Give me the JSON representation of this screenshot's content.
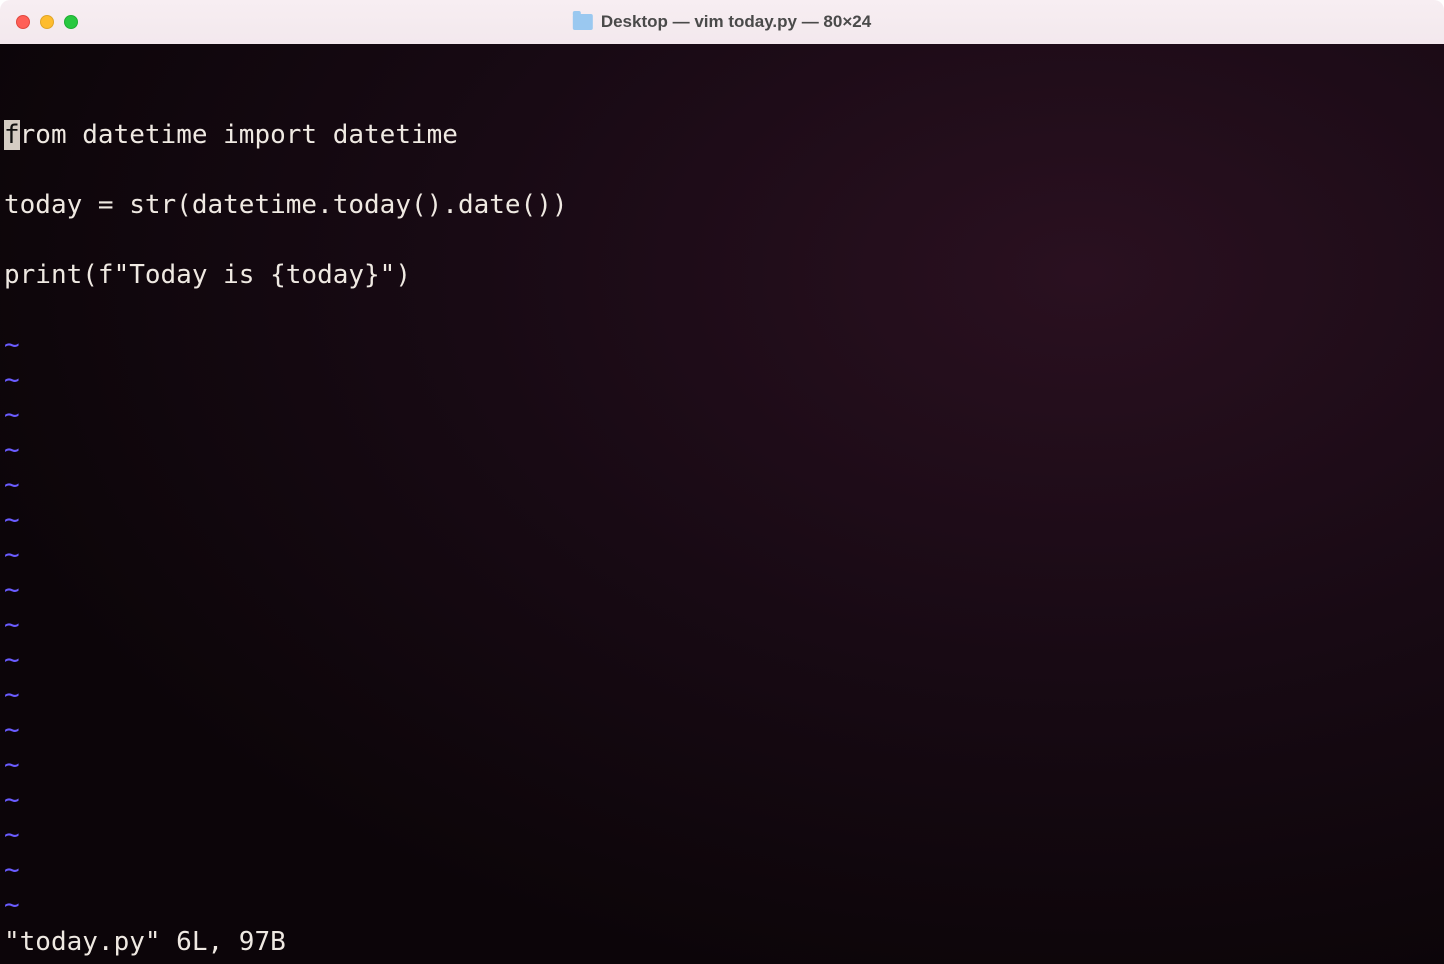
{
  "titlebar": {
    "title": "Desktop — vim today.py — 80×24"
  },
  "editor": {
    "lines": [
      "from datetime import datetime",
      "",
      "today = str(datetime.today().date())",
      "",
      "print(f\"Today is {today}\")"
    ],
    "cursor": {
      "row": 0,
      "col": 0
    },
    "tilde": "~",
    "empty_rows": 17
  },
  "status": {
    "text": "\"today.py\" 6L, 97B"
  }
}
